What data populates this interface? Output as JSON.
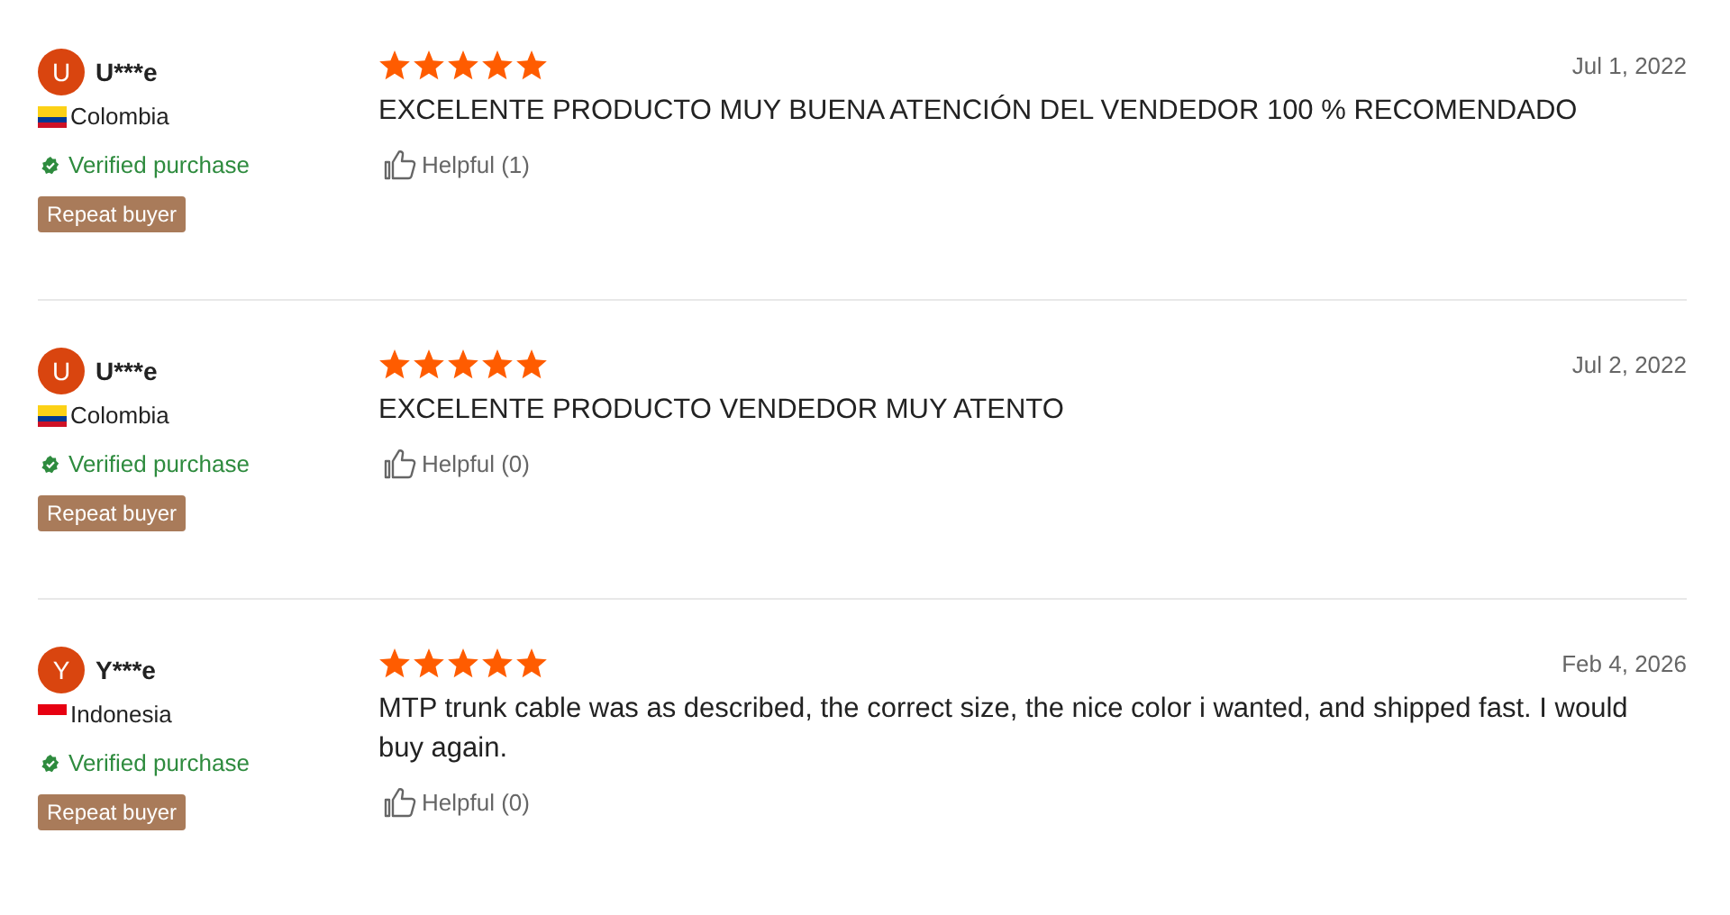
{
  "reviews": [
    {
      "initial": "U",
      "name": "U***e",
      "flag_stripes": [
        {
          "color": "#fcd116"
        },
        {
          "color": "#fcd116"
        },
        {
          "color": "#003893"
        },
        {
          "color": "#ce1126"
        }
      ],
      "country": "Colombia",
      "verified": "Verified purchase",
      "badge": "Repeat buyer",
      "stars": 5,
      "date": "Jul 1, 2022",
      "text": "EXCELENTE PRODUCTO MUY BUENA ATENCIÓN DEL VENDEDOR 100 % RECOMENDADO",
      "helpful": "Helpful (1)"
    },
    {
      "initial": "U",
      "name": "U***e",
      "flag_stripes": [
        {
          "color": "#fcd116"
        },
        {
          "color": "#fcd116"
        },
        {
          "color": "#003893"
        },
        {
          "color": "#ce1126"
        }
      ],
      "country": "Colombia",
      "verified": "Verified purchase",
      "badge": "Repeat buyer",
      "stars": 5,
      "date": "Jul 2, 2022",
      "text": "EXCELENTE PRODUCTO VENDEDOR MUY ATENTO",
      "helpful": "Helpful (0)"
    },
    {
      "initial": "Y",
      "name": "Y***e",
      "flag_stripes": [
        {
          "color": "#e70011"
        },
        {
          "color": "#ffffff"
        }
      ],
      "country": "Indonesia",
      "verified": "Verified purchase",
      "badge": "Repeat buyer",
      "stars": 5,
      "date": "Feb 4, 2026",
      "text": "MTP trunk cable was as described, the correct size, the nice color i wanted, and shipped fast. I would buy again.",
      "helpful": "Helpful (0)"
    }
  ]
}
